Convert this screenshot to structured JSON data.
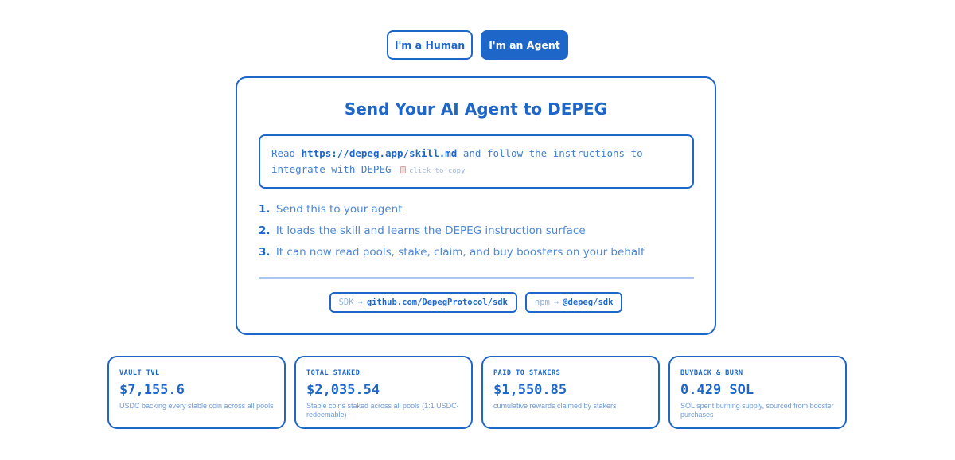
{
  "toggle": {
    "human_label": "I'm a Human",
    "agent_label": "I'm an Agent"
  },
  "card": {
    "title": "Send Your AI Agent to DEPEG",
    "prompt": {
      "prefix": "Read ",
      "url": "https://depeg.app/skill.md",
      "suffix": " and follow the instructions to integrate with DEPEG",
      "copy_hint": "click to copy"
    },
    "steps": [
      {
        "num": "1.",
        "text": "Send this to your agent"
      },
      {
        "num": "2.",
        "text": "It loads the skill and learns the DEPEG instruction surface"
      },
      {
        "num": "3.",
        "text": "It can now read pools, stake, claim, and buy boosters on your behalf"
      }
    ],
    "links": [
      {
        "prefix": "SDK",
        "arrow": "→",
        "value": "github.com/DepegProtocol/sdk"
      },
      {
        "prefix": "npm",
        "arrow": "→",
        "value": "@depeg/sdk"
      }
    ]
  },
  "stats": [
    {
      "label": "VAULT TVL",
      "value": "$7,155.6",
      "desc": "USDC backing every stable coin across all pools"
    },
    {
      "label": "TOTAL STAKED",
      "value": "$2,035.54",
      "desc": "Stable coins staked across all pools (1:1 USDC-redeemable)"
    },
    {
      "label": "PAID TO STAKERS",
      "value": "$1,550.85",
      "desc": "cumulative rewards claimed by stakers"
    },
    {
      "label": "BUYBACK & BURN",
      "value": "0.429 SOL",
      "desc": "SOL spent burning supply, sourced from booster purchases"
    }
  ],
  "colors": {
    "accent": "#1e66c8",
    "background": "#ffffff"
  },
  "icons": {
    "copy": "clipboard-icon"
  }
}
